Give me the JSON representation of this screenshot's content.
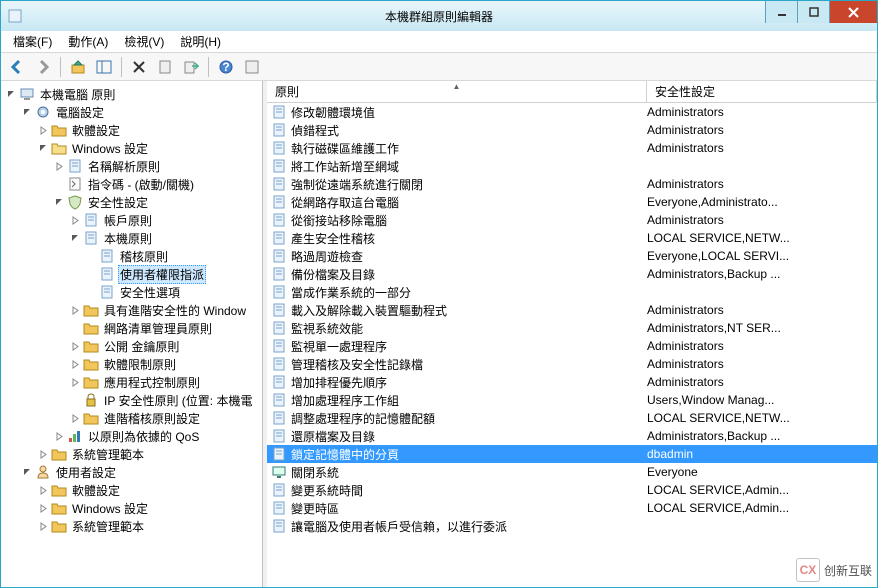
{
  "window": {
    "title": "本機群組原則編輯器"
  },
  "menu": {
    "file": "檔案(F)",
    "action": "動作(A)",
    "view": "檢視(V)",
    "help": "說明(H)"
  },
  "columns": {
    "policy": "原則",
    "security": "安全性設定"
  },
  "tree": {
    "root": "本機電腦 原則",
    "computer": "電腦設定",
    "software": "軟體設定",
    "windows": "Windows 設定",
    "nameres": "名稱解析原則",
    "scripts": "指令碼 - (啟動/關機)",
    "secset": "安全性設定",
    "account": "帳戶原則",
    "local": "本機原則",
    "audit": "稽核原則",
    "userrights": "使用者權限指派",
    "secopt": "安全性選項",
    "advfw": "具有進階安全性的 Window",
    "netlist": "網路清單管理員原則",
    "pubkey": "公開 金鑰原則",
    "softrestrict": "軟體限制原則",
    "appctrl": "應用程式控制原則",
    "ipsec": "IP 安全性原則 (位置: 本機電",
    "advaudit": "進階稽核原則設定",
    "qos": "以原則為依據的 QoS",
    "admintmpl": "系統管理範本",
    "user": "使用者設定",
    "usoftware": "軟體設定",
    "uwindows": "Windows 設定",
    "uadmintmpl": "系統管理範本"
  },
  "rows": [
    {
      "icon": "policy",
      "label": "修改韌體環境值",
      "val": "Administrators"
    },
    {
      "icon": "policy",
      "label": "偵錯程式",
      "val": "Administrators"
    },
    {
      "icon": "policy",
      "label": "執行磁碟區維護工作",
      "val": "Administrators"
    },
    {
      "icon": "policy",
      "label": "將工作站新增至網域",
      "val": ""
    },
    {
      "icon": "policy",
      "label": "強制從遠端系統進行關閉",
      "val": "Administrators"
    },
    {
      "icon": "policy",
      "label": "從網路存取這台電腦",
      "val": "Everyone,Administrato..."
    },
    {
      "icon": "policy",
      "label": "從銜接站移除電腦",
      "val": "Administrators"
    },
    {
      "icon": "policy",
      "label": "產生安全性稽核",
      "val": "LOCAL SERVICE,NETW..."
    },
    {
      "icon": "policy",
      "label": "略過周遊檢查",
      "val": "Everyone,LOCAL SERVI..."
    },
    {
      "icon": "policy",
      "label": "備份檔案及目錄",
      "val": "Administrators,Backup ..."
    },
    {
      "icon": "policy",
      "label": "當成作業系統的一部分",
      "val": ""
    },
    {
      "icon": "policy",
      "label": "載入及解除載入裝置驅動程式",
      "val": "Administrators"
    },
    {
      "icon": "policy",
      "label": "監視系統效能",
      "val": "Administrators,NT SER..."
    },
    {
      "icon": "policy",
      "label": "監視單一處理程序",
      "val": "Administrators"
    },
    {
      "icon": "policy",
      "label": "管理稽核及安全性記錄檔",
      "val": "Administrators"
    },
    {
      "icon": "policy",
      "label": "增加排程優先順序",
      "val": "Administrators"
    },
    {
      "icon": "policy",
      "label": "增加處理程序工作組",
      "val": "Users,Window Manag..."
    },
    {
      "icon": "policy",
      "label": "調整處理程序的記憶體配額",
      "val": "LOCAL SERVICE,NETW..."
    },
    {
      "icon": "policy",
      "label": "還原檔案及目錄",
      "val": "Administrators,Backup ..."
    },
    {
      "icon": "policy",
      "label": "鎖定記憶體中的分頁",
      "val": "dbadmin",
      "sel": true
    },
    {
      "icon": "monitor",
      "label": "關閉系統",
      "val": "Everyone"
    },
    {
      "icon": "policy",
      "label": "變更系統時間",
      "val": "LOCAL SERVICE,Admin..."
    },
    {
      "icon": "policy",
      "label": "變更時區",
      "val": "LOCAL SERVICE,Admin..."
    },
    {
      "icon": "policy",
      "label": "讓電腦及使用者帳戶受信賴，以進行委派",
      "val": ""
    }
  ],
  "watermark": {
    "text": "创新互联",
    "logo": "CX"
  }
}
